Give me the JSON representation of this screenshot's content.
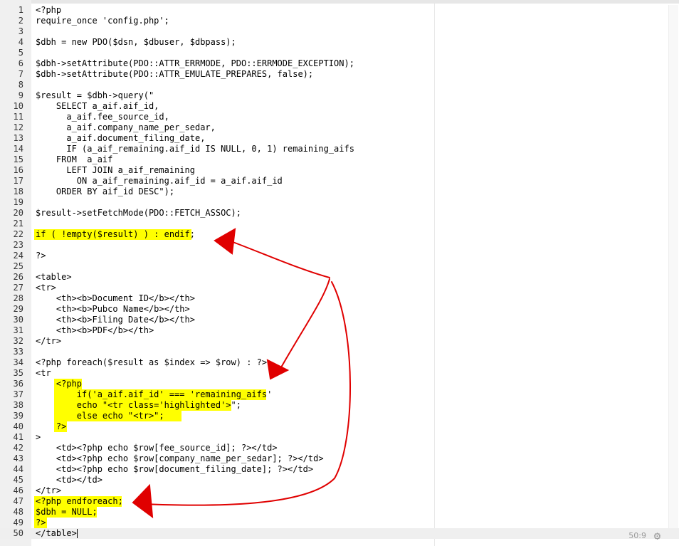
{
  "editor": {
    "lines": [
      "<?php",
      "require_once 'config.php';",
      "",
      "$dbh = new PDO($dsn, $dbuser, $dbpass);",
      "",
      "$dbh->setAttribute(PDO::ATTR_ERRMODE, PDO::ERRMODE_EXCEPTION);",
      "$dbh->setAttribute(PDO::ATTR_EMULATE_PREPARES, false);",
      "",
      "$result = $dbh->query(\"",
      "    SELECT a_aif.aif_id,",
      "      a_aif.fee_source_id,",
      "      a_aif.company_name_per_sedar,",
      "      a_aif.document_filing_date,",
      "      IF (a_aif_remaining.aif_id IS NULL, 0, 1) remaining_aifs",
      "    FROM  a_aif",
      "      LEFT JOIN a_aif_remaining",
      "        ON a_aif_remaining.aif_id = a_aif.aif_id",
      "    ORDER BY aif_id DESC\");",
      "",
      "$result->setFetchMode(PDO::FETCH_ASSOC);",
      "",
      "if ( !empty($result) ) : endif;",
      "",
      "?>",
      "",
      "<table>",
      "<tr>",
      "    <th><b>Document ID</b></th>",
      "    <th><b>Pubco Name</b></th>",
      "    <th><b>Filing Date</b></th>",
      "    <th><b>PDF</b></th>",
      "</tr>",
      "",
      "<?php foreach($result as $index => $row) : ?>",
      "<tr",
      "    <?php",
      "        if('a_aif.aif_id' === 'remaining_aifs'",
      "        echo \"<tr class='highlighted'>\";",
      "        else echo \"<tr>\";",
      "    ?>",
      ">",
      "    <td><?php echo $row[fee_source_id]; ?></td>",
      "    <td><?php echo $row[company_name_per_sedar]; ?></td>",
      "    <td><?php echo $row[document_filing_date]; ?></td>",
      "    <td></td>",
      "</tr>",
      "<?php endforeach;",
      "$dbh = NULL;",
      "?>",
      "</table>"
    ],
    "status": "50:9",
    "settings_icon": "gear-icon",
    "highlight_color": "#ffff00",
    "annotation_color": "#e00000"
  }
}
